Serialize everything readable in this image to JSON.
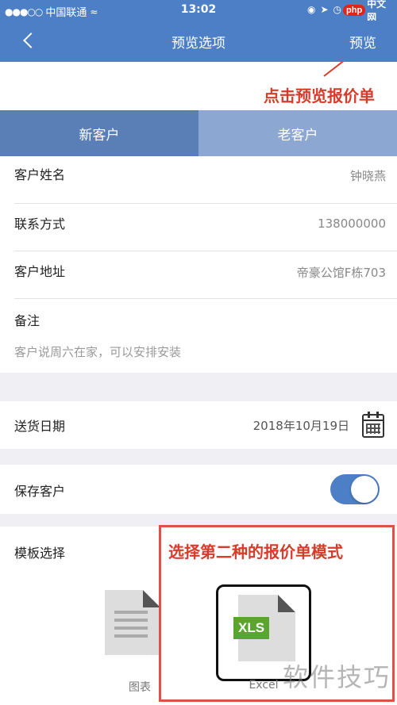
{
  "status_bar": {
    "signal": "●●●○○",
    "carrier": "中国联通",
    "time": "13:02",
    "logo_php": "php",
    "logo_cn": "中文网"
  },
  "header": {
    "title": "预览选项",
    "preview_label": "预览"
  },
  "annotations": {
    "top_hint": "点击预览报价单",
    "template_hint": "选择第二种的报价单模式"
  },
  "tabs": [
    {
      "label": "新客户",
      "active": true
    },
    {
      "label": "老客户",
      "active": false
    }
  ],
  "customer": {
    "name_label": "客户姓名",
    "name_value": "钟晓燕",
    "phone_label": "联系方式",
    "phone_value": "138000000",
    "address_label": "客户地址",
    "address_value": "帝豪公馆F栋703",
    "remark_label": "备注",
    "remark_value": "客户说周六在家，可以安排安装"
  },
  "delivery": {
    "label": "送货日期",
    "value": "2018年10月19日"
  },
  "save_customer": {
    "label": "保存客户",
    "enabled": true
  },
  "template": {
    "label": "模板选择",
    "options": [
      {
        "caption": "图表"
      },
      {
        "caption": "Excel",
        "badge": "XLS"
      }
    ]
  },
  "watermark": "软件技巧",
  "colors": {
    "accent": "#4d7fc7",
    "annotation": "#d93b2b",
    "xls_green": "#5aa52f"
  }
}
